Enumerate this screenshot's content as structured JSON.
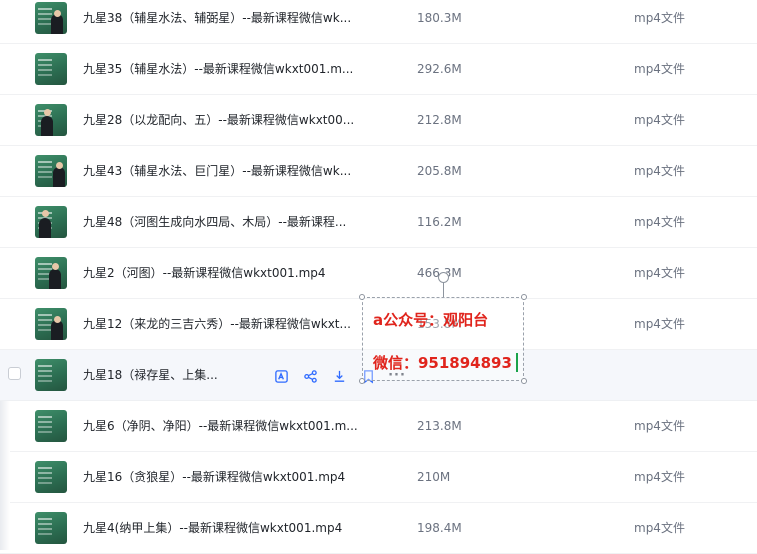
{
  "files": [
    {
      "name": "九星38（辅星水法、辅弼星）--最新课程微信wk...",
      "size": "180.3M",
      "type": "mp4文件"
    },
    {
      "name": "九星35（辅星水法）--最新课程微信wkxt001.m...",
      "size": "292.6M",
      "type": "mp4文件"
    },
    {
      "name": "九星28（以龙配向、五）--最新课程微信wkxt00...",
      "size": "212.8M",
      "type": "mp4文件"
    },
    {
      "name": "九星43（辅星水法、巨门星）--最新课程微信wk...",
      "size": "205.8M",
      "type": "mp4文件"
    },
    {
      "name": "九星48（河图生成向水四局、木局）--最新课程...",
      "size": "116.2M",
      "type": "mp4文件"
    },
    {
      "name": "九星2（河图）--最新课程微信wkxt001.mp4",
      "size": "466.3M",
      "type": "mp4文件"
    },
    {
      "name": "九星12（来龙的三吉六秀）--最新课程微信wkxt...",
      "size": "153.8M",
      "type": "mp4文件"
    },
    {
      "name": "九星18（禄存星、上集...",
      "size": "",
      "type": "",
      "hover": true
    },
    {
      "name": "九星6（净阴、净阳）--最新课程微信wkxt001.m...",
      "size": "213.8M",
      "type": "mp4文件"
    },
    {
      "name": "九星16（贪狼星）--最新课程微信wkxt001.mp4",
      "size": "210M",
      "type": "mp4文件"
    },
    {
      "name": "九星4(纳甲上集）--最新课程微信wkxt001.mp4",
      "size": "198.4M",
      "type": "mp4文件"
    }
  ],
  "hover_actions": {
    "icons": [
      "translate-icon",
      "share-icon",
      "download-icon",
      "bookmark-icon",
      "more-icon"
    ],
    "more_label": "···"
  },
  "overlay": {
    "line1": "a公众号：观阳台",
    "line2": "微信：951894893"
  },
  "colors": {
    "accent": "#2f6bff",
    "overlay_text": "#e0241c",
    "caret": "#1aa34a"
  }
}
